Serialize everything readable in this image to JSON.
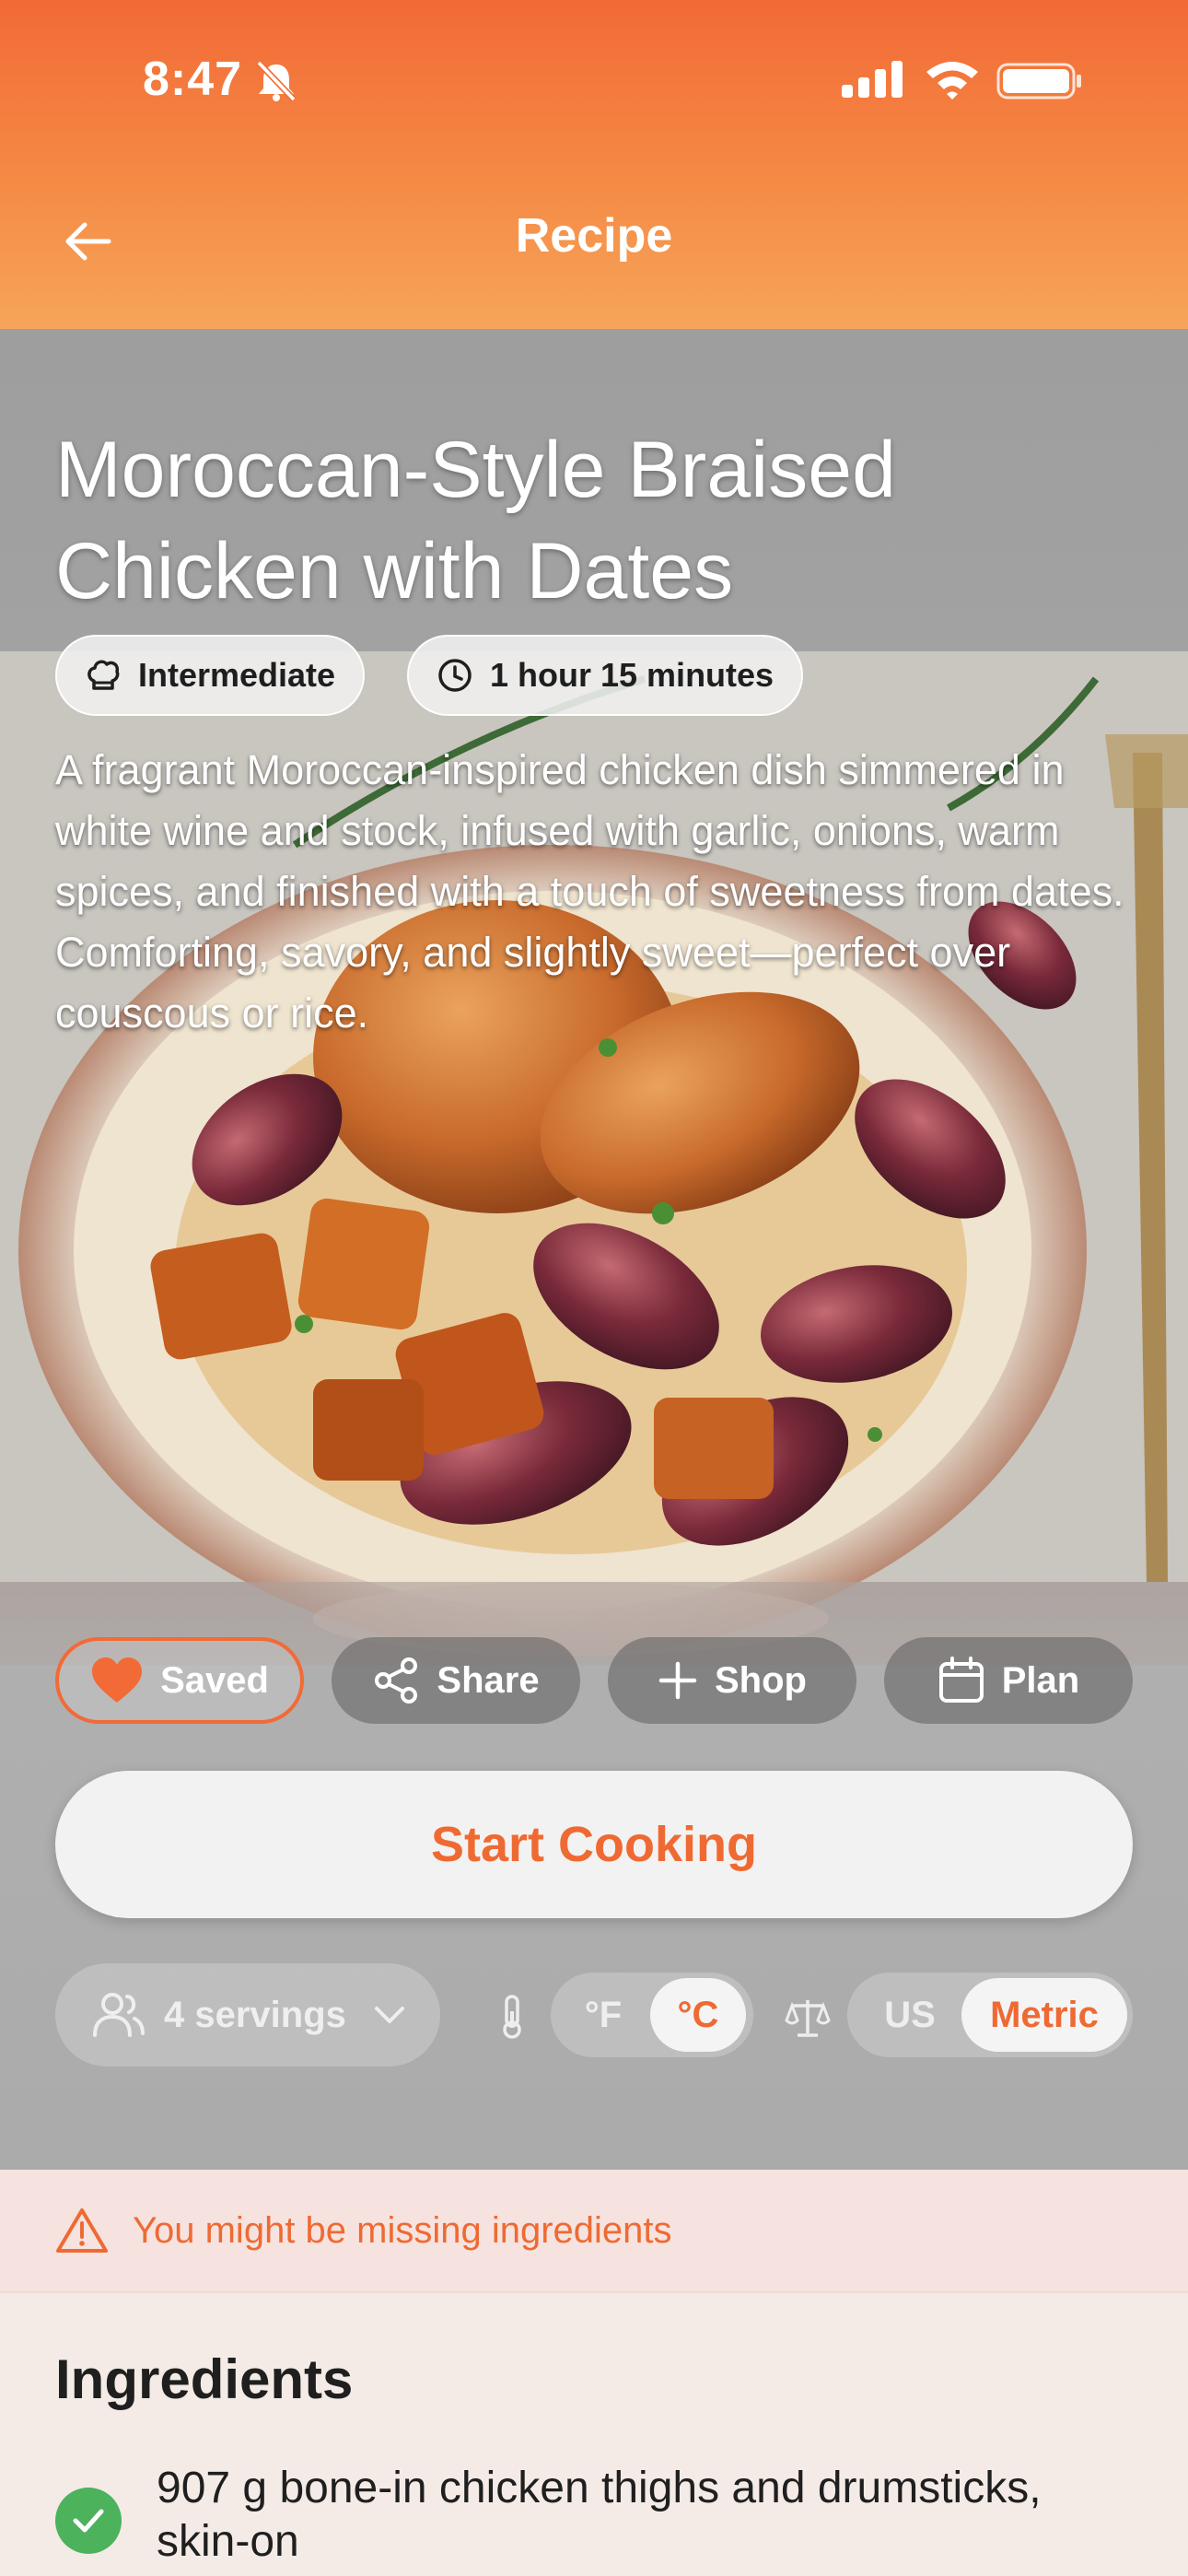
{
  "status_bar": {
    "time": "8:47"
  },
  "header": {
    "title": "Recipe"
  },
  "recipe": {
    "title": "Moroccan-Style Braised Chicken with Dates",
    "difficulty": "Intermediate",
    "duration": "1 hour 15 minutes",
    "description": "A fragrant Moroccan-inspired chicken dish simmered in white wine and stock, infused with garlic, onions, warm spices, and finished with a touch of sweetness from dates. Comforting, savory, and slightly sweet—perfect over couscous or rice."
  },
  "actions": {
    "saved": "Saved",
    "share": "Share",
    "shop": "Shop",
    "plan": "Plan"
  },
  "start_cooking": "Start Cooking",
  "settings": {
    "servings": "4 servings",
    "temperature_options": [
      "°F",
      "°C"
    ],
    "temperature_selected": "°C",
    "unit_options": [
      "US",
      "Metric"
    ],
    "unit_selected": "Metric"
  },
  "warning": "You might be missing ingredients",
  "ingredients": {
    "heading": "Ingredients",
    "items": [
      {
        "text": "907 g bone-in chicken thighs and drumsticks, skin-on",
        "checked": true
      }
    ]
  },
  "colors": {
    "accent": "#ef6a33",
    "header_top": "#f26a36",
    "header_bottom": "#f6a55a",
    "check": "#4cb25c"
  }
}
